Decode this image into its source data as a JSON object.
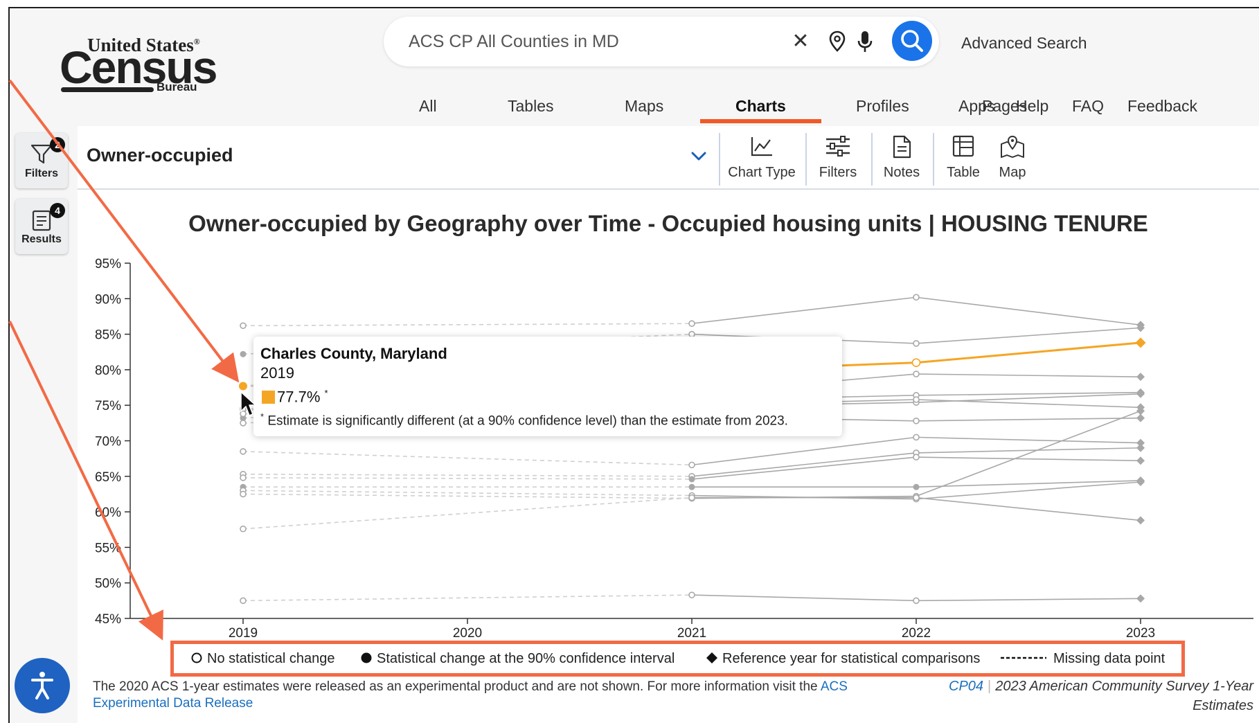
{
  "header": {
    "logo": {
      "line1": "United States",
      "reg": "®",
      "line2": "Census",
      "line3": "Bureau"
    },
    "search": {
      "value": "ACS CP All Counties in MD",
      "clear_icon": "close-icon",
      "location_icon": "location-pin-icon",
      "mic_icon": "microphone-icon",
      "search_icon": "search-icon"
    },
    "advanced_search": "Advanced Search",
    "tabs": [
      {
        "label": "All"
      },
      {
        "label": "Tables"
      },
      {
        "label": "Maps"
      },
      {
        "label": "Charts",
        "active": true
      },
      {
        "label": "Profiles"
      },
      {
        "label": "Apps"
      },
      {
        "label": "Pages"
      },
      {
        "label": "Help"
      },
      {
        "label": "FAQ"
      },
      {
        "label": "Feedback"
      }
    ]
  },
  "rail": {
    "filters": {
      "label": "Filters",
      "count": "2"
    },
    "results": {
      "label": "Results",
      "count": "4"
    }
  },
  "toolbar": {
    "variable": "Owner-occupied",
    "buttons": [
      {
        "label": "Chart Type",
        "icon": "line-chart-icon"
      },
      {
        "label": "Filters",
        "icon": "sliders-icon"
      },
      {
        "label": "Notes",
        "icon": "document-icon"
      },
      {
        "label": "Table",
        "icon": "table-icon"
      },
      {
        "label": "Map",
        "icon": "map-icon"
      }
    ]
  },
  "tooltip": {
    "geography": "Charles County, Maryland",
    "year": "2019",
    "value": "77.7%",
    "marker": "*",
    "note": "Estimate is significantly different (at a 90% confidence level) than the estimate from 2023."
  },
  "legend": {
    "items": [
      {
        "symbol": "open-circle",
        "label": "No statistical change"
      },
      {
        "symbol": "filled-circle",
        "label": "Statistical change at the 90% confidence interval"
      },
      {
        "symbol": "diamond",
        "label": "Reference year for statistical comparisons"
      },
      {
        "symbol": "dashed-line",
        "label": "Missing data point"
      }
    ]
  },
  "footnote": {
    "text": "The 2020 ACS 1-year estimates were released as an experimental product and are not shown. For more information visit the ",
    "link": "ACS Experimental Data Release"
  },
  "source": {
    "table_id": "CP04",
    "survey": "2023 American Community Survey 1-Year Estimates"
  },
  "colors": {
    "accent": "#f05a28",
    "highlight_series": "#f5a524",
    "series": "#a8a8a8",
    "link": "#1a6fbf",
    "a11y_button": "#1f62c1",
    "annotation": "#f26a45"
  },
  "accessibility_icon": "accessibility-icon",
  "chart_data": {
    "type": "line",
    "title": "Owner-occupied by Geography over Time - Occupied housing units | HOUSING TENURE",
    "x": [
      "2019",
      "2020",
      "2021",
      "2022",
      "2023"
    ],
    "y_ticks": [
      "95%",
      "90%",
      "85%",
      "80%",
      "75%",
      "70%",
      "65%",
      "60%",
      "55%",
      "50%",
      "45%"
    ],
    "ylim": [
      45,
      95
    ],
    "grid": false,
    "highlight": "Charles County, Maryland",
    "series": [
      {
        "name": "Charles County, Maryland",
        "highlight": true,
        "values": [
          77.7,
          null,
          79.8,
          81.0,
          83.8
        ],
        "stat_change": [
          true,
          null,
          false,
          false,
          false
        ]
      },
      {
        "values": [
          86.2,
          null,
          86.5,
          90.2,
          86.3
        ],
        "stat_change": [
          false,
          null,
          false,
          false,
          false
        ]
      },
      {
        "values": [
          82.2,
          null,
          85.0,
          83.7,
          85.9
        ],
        "stat_change": [
          true,
          null,
          false,
          false,
          false
        ]
      },
      {
        "values": [
          74.3,
          null,
          76.7,
          79.4,
          79.0
        ],
        "stat_change": [
          true,
          null,
          false,
          false,
          false
        ]
      },
      {
        "values": [
          73.2,
          null,
          75.7,
          76.4,
          76.8
        ],
        "stat_change": [
          true,
          null,
          false,
          false,
          false
        ]
      },
      {
        "values": [
          72.5,
          null,
          74.8,
          75.4,
          76.6
        ],
        "stat_change": [
          false,
          null,
          false,
          false,
          false
        ]
      },
      {
        "values": [
          74.5,
          null,
          75.0,
          75.8,
          74.7
        ],
        "stat_change": [
          false,
          null,
          false,
          false,
          false
        ]
      },
      {
        "values": [
          73.8,
          null,
          73.4,
          72.8,
          73.2
        ],
        "stat_change": [
          false,
          null,
          false,
          false,
          false
        ]
      },
      {
        "values": [
          68.5,
          null,
          66.6,
          70.5,
          69.7
        ],
        "stat_change": [
          false,
          null,
          false,
          false,
          false
        ]
      },
      {
        "values": [
          65.3,
          null,
          65.0,
          68.3,
          69.0
        ],
        "stat_change": [
          false,
          null,
          false,
          false,
          false
        ]
      },
      {
        "values": [
          64.8,
          null,
          64.6,
          67.7,
          67.2
        ],
        "stat_change": [
          false,
          null,
          true,
          false,
          false
        ]
      },
      {
        "values": [
          63.5,
          null,
          63.5,
          63.5,
          64.4
        ],
        "stat_change": [
          true,
          null,
          true,
          true,
          false
        ]
      },
      {
        "values": [
          63.0,
          null,
          62.3,
          61.8,
          64.2
        ],
        "stat_change": [
          false,
          null,
          false,
          false,
          false
        ]
      },
      {
        "values": [
          62.5,
          null,
          61.9,
          62.2,
          74.2
        ],
        "stat_change": [
          false,
          null,
          false,
          false,
          false
        ]
      },
      {
        "values": [
          57.6,
          null,
          62.0,
          62.0,
          58.8
        ],
        "stat_change": [
          false,
          null,
          false,
          false,
          false
        ]
      },
      {
        "values": [
          47.5,
          null,
          48.3,
          47.5,
          47.8
        ],
        "stat_change": [
          false,
          null,
          false,
          false,
          false
        ]
      }
    ]
  }
}
